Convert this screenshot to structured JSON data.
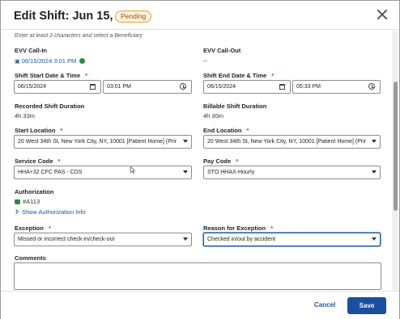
{
  "modal": {
    "title": "Edit Shift: Jun 15, 2024",
    "status_badge": "Pending"
  },
  "hint": "Enter at least 2 characters and select a Beneficiary",
  "evv_call_in": {
    "label": "EVV Call-In",
    "value": "06/15/2024 3:01 PM"
  },
  "evv_call_out": {
    "label": "EVV Call-Out",
    "value": "--"
  },
  "shift_start": {
    "label": "Shift Start Date & Time",
    "required": "*",
    "date": "06/15/2024",
    "time": "03:01 PM"
  },
  "shift_end": {
    "label": "Shift End Date & Time",
    "required": "*",
    "date": "06/15/2024",
    "time": "05:33 PM"
  },
  "recorded_duration": {
    "label": "Recorded Shift Duration",
    "value": "4h 33m"
  },
  "billable_duration": {
    "label": "Billable Shift Duration",
    "value": "4h 30m"
  },
  "start_location": {
    "label": "Start Location",
    "required": "*",
    "value": "20 West 34th St, New York City, NY, 10001 [Patient Home] (Prir"
  },
  "end_location": {
    "label": "End Location",
    "required": "*",
    "value": "20 West 34th St, New York City, NY, 10001 [Patient Home] (Prir"
  },
  "service_code": {
    "label": "Service Code",
    "required": "*",
    "value": "HHA+32 CFC PAS - CDS"
  },
  "pay_code": {
    "label": "Pay Code",
    "required": "*",
    "value": "STO HHAX-Hourly"
  },
  "authorization": {
    "label": "Authorization",
    "value": "#A113",
    "link": "Show Authorization Info"
  },
  "exception": {
    "label": "Exception",
    "required": "*",
    "value": "Missed or incorrect check-in/check-out"
  },
  "reason": {
    "label": "Reason for Exception",
    "required": "*",
    "value": "Checked in/out by accident"
  },
  "comments": {
    "label": "Comments",
    "value": ""
  },
  "footer": {
    "cancel": "Cancel",
    "save": "Save"
  },
  "colors": {
    "primary": "#1a4fa0",
    "link": "#1a56a8",
    "required": "#d0312d",
    "pending_border": "#e2a23b",
    "success": "#2e8b3d"
  },
  "icons": [
    "close-icon",
    "check-circle-icon",
    "calendar-icon",
    "clock-icon",
    "chevron-down-icon",
    "thumbs-up-icon",
    "chevron-right-icon"
  ]
}
